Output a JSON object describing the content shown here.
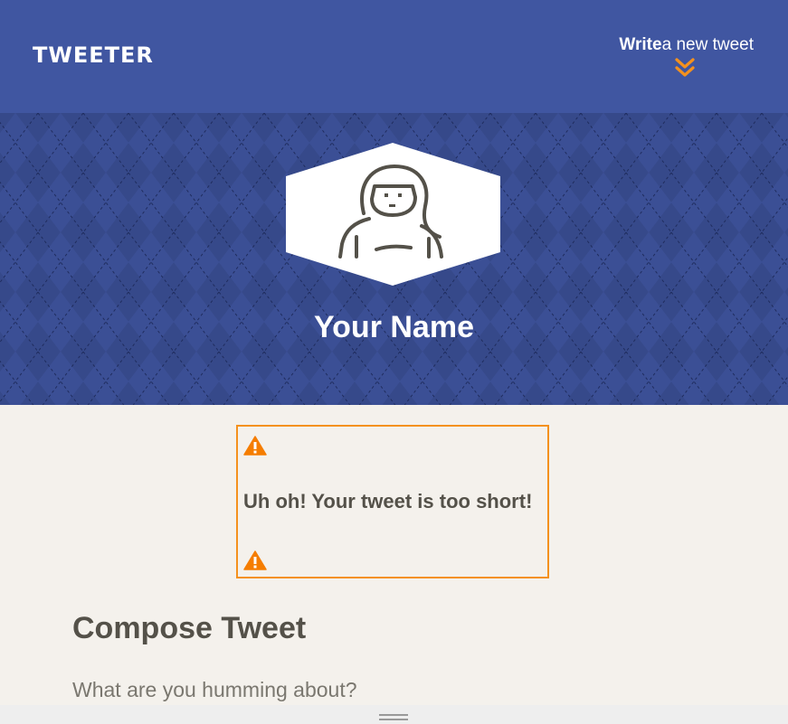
{
  "navbar": {
    "logo": "TWEETER",
    "write_bold": "Write",
    "write_rest": "a new tweet",
    "chevron_icon": "double-chevron-down-icon",
    "background_color": "#4056a1",
    "accent_color": "#f4911e"
  },
  "header": {
    "avatar_icon": "user-avatar-icon",
    "name": "Your Name"
  },
  "error": {
    "icon": "warning-icon",
    "message": "Uh oh! Your tweet is too short!",
    "border_color": "#f4911e"
  },
  "compose": {
    "title": "Compose Tweet",
    "placeholder": "What are you humming about?"
  },
  "bottom_bar": {
    "icon": "drag-handle-icon"
  }
}
